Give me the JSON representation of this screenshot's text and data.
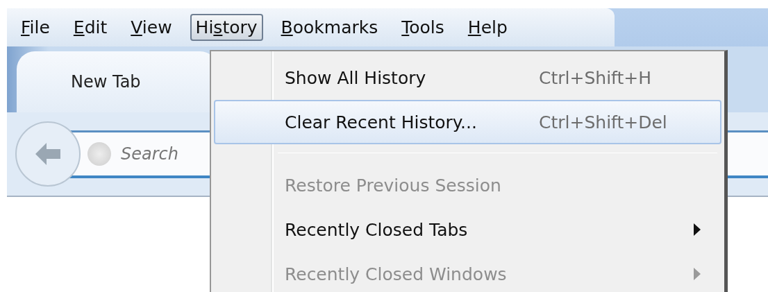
{
  "menu_bar": [
    {
      "key": "F",
      "post": "ile",
      "selected": false
    },
    {
      "key": "E",
      "post": "dit",
      "selected": false
    },
    {
      "key": "V",
      "post": "iew",
      "selected": false
    },
    {
      "pre": "Hi",
      "key": "s",
      "post": "tory",
      "selected": true
    },
    {
      "key": "B",
      "post": "ookmarks",
      "selected": false
    },
    {
      "key": "T",
      "post": "ools",
      "selected": false
    },
    {
      "key": "H",
      "post": "elp",
      "selected": false
    }
  ],
  "tab": {
    "label": "New Tab"
  },
  "search": {
    "placeholder": "Search"
  },
  "history_menu": [
    {
      "kind": "item",
      "label": "Show All History",
      "shortcut": "Ctrl+Shift+H",
      "selected": false,
      "disabled": false
    },
    {
      "kind": "item",
      "label": "Clear Recent History...",
      "shortcut": "Ctrl+Shift+Del",
      "selected": true,
      "disabled": false
    },
    {
      "kind": "separator"
    },
    {
      "kind": "item",
      "label": "Restore Previous Session",
      "selected": false,
      "disabled": true
    },
    {
      "kind": "submenu",
      "label": "Recently Closed Tabs",
      "selected": false,
      "disabled": false
    },
    {
      "kind": "submenu",
      "label": "Recently Closed Windows",
      "selected": false,
      "disabled": true
    }
  ]
}
